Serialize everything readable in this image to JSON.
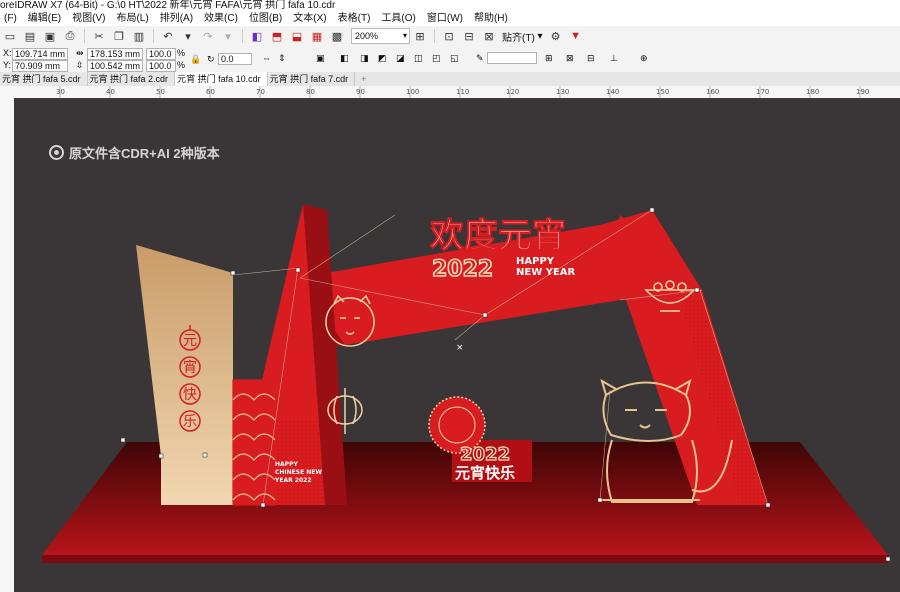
{
  "window": {
    "title": "oreIDRAW X7 (64-Bit) - G:\\0 HT\\2022 新年\\元宵 FAFA\\元宵 拱门 fafa 10.cdr"
  },
  "menu": [
    "(F)",
    "编辑(E)",
    "视图(V)",
    "布局(L)",
    "排列(A)",
    "效果(C)",
    "位图(B)",
    "文本(X)",
    "表格(T)",
    "工具(O)",
    "窗口(W)",
    "帮助(H)"
  ],
  "toolbar": {
    "zoom": "200%",
    "snap_label": "贴齐(T)"
  },
  "properties": {
    "x_label": "X:",
    "x_value": "109.714 mm",
    "y_label": "Y:",
    "y_value": "70.909 mm",
    "w_value": "178.153 mm",
    "h_value": "100.542 mm",
    "scale_w": "100.0",
    "scale_h": "100.0",
    "pct": "%",
    "rotation": "0.0"
  },
  "tabs": [
    "元宵 拱门 fafa 5.cdr",
    "元宵 拱门 fafa 2.cdr",
    "元宵 拱门 fafa 10.cdr",
    "元宵 拱门 fafa 7.cdr"
  ],
  "active_tab": 2,
  "ruler": {
    "ticks": [
      "30",
      "40",
      "50",
      "60",
      "70",
      "80",
      "90",
      "100",
      "110",
      "120",
      "130",
      "140",
      "150",
      "160",
      "170",
      "180",
      "190"
    ]
  },
  "design": {
    "watermark": "原文件含CDR+AI 2种版本",
    "headline": "欢度元宵",
    "year": "2022",
    "happy": "HAPPY",
    "new_year": "NEW YEAR",
    "pillar_chars": [
      "元",
      "宵",
      "快",
      "乐"
    ],
    "small_en_1": "HAPPY",
    "small_en_2": "CHINESE NEW",
    "small_en_3": "YEAR 2022",
    "badge_year": "2022",
    "badge_text": "元宵快乐",
    "colors": {
      "red": "#d81c1f",
      "dark_red": "#8e0e12",
      "gold": "#e8c391",
      "canvas": "#3a3637"
    }
  }
}
